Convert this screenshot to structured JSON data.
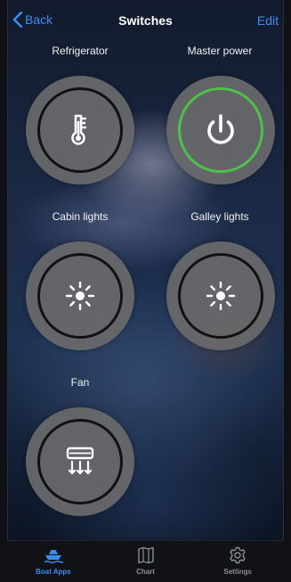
{
  "nav": {
    "back_label": "Back",
    "title": "Switches",
    "edit_label": "Edit"
  },
  "switches": [
    {
      "label": "Refrigerator",
      "icon": "thermometer-icon",
      "state": "off"
    },
    {
      "label": "Master power",
      "icon": "power-icon",
      "state": "on"
    },
    {
      "label": "Cabin lights",
      "icon": "light-icon",
      "state": "off"
    },
    {
      "label": "Galley lights",
      "icon": "light-icon",
      "state": "off"
    },
    {
      "label": "Fan",
      "icon": "fan-icon",
      "state": "off"
    }
  ],
  "tabs": [
    {
      "label": "Boat Apps",
      "icon": "boat-icon",
      "active": true
    },
    {
      "label": "Chart",
      "icon": "chart-icon",
      "active": false
    },
    {
      "label": "Settings",
      "icon": "gear-icon",
      "active": false
    }
  ],
  "colors": {
    "accent": "#3d8ef2",
    "on_ring": "#4cc24a",
    "button_fill": "#69696c"
  }
}
